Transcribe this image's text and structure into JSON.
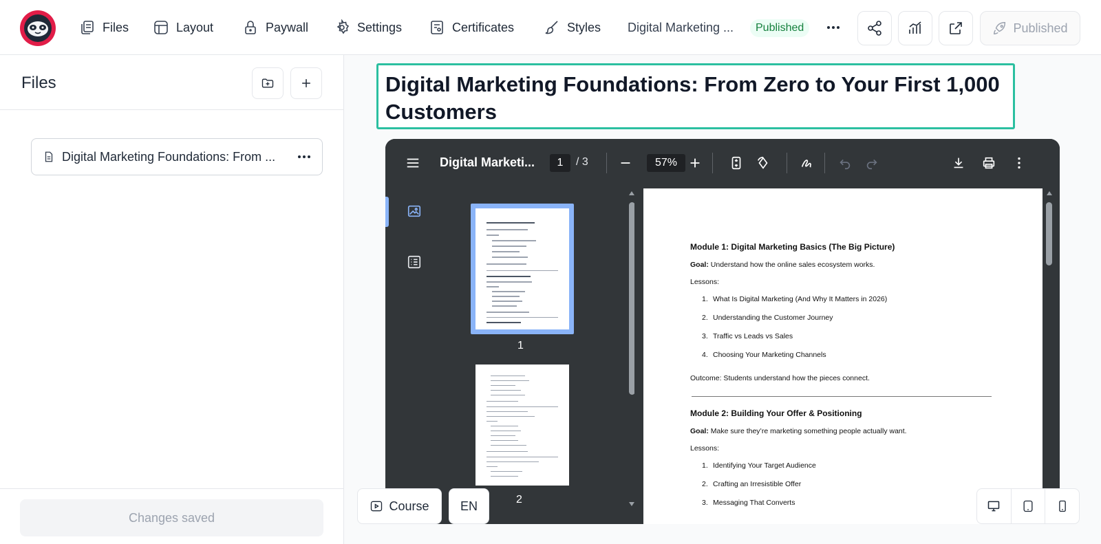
{
  "topbar": {
    "nav": [
      {
        "label": "Files",
        "icon": "files-icon"
      },
      {
        "label": "Layout",
        "icon": "layout-icon"
      },
      {
        "label": "Paywall",
        "icon": "lock-icon"
      },
      {
        "label": "Settings",
        "icon": "gear-icon"
      },
      {
        "label": "Certificates",
        "icon": "certificate-icon"
      },
      {
        "label": "Styles",
        "icon": "brush-icon"
      }
    ],
    "course_name": "Digital Marketing ...",
    "status_badge": "Published",
    "publish_button": "Published",
    "accent_color": "#2bbfa0"
  },
  "sidebar": {
    "title": "Files",
    "file_item": "Digital Marketing Foundations: From ...",
    "footer_status": "Changes saved"
  },
  "main": {
    "page_title": "Digital Marketing Foundations: From Zero to Your First 1,000 Customers",
    "viewer": {
      "doc_title": "Digital Marketi...",
      "current_page": "1",
      "total_pages": "/ 3",
      "zoom": "57%",
      "thumb_labels": [
        "1",
        "2"
      ],
      "content": {
        "module1_heading": "Module 1: Digital Marketing Basics (The Big Picture)",
        "module1_goal_label": "Goal:",
        "module1_goal": "Understand how the online sales ecosystem works.",
        "lessons_label": "Lessons:",
        "module1_lessons": [
          "What Is Digital Marketing (And Why It Matters in 2026)",
          "Understanding the Customer Journey",
          "Traffic vs Leads vs Sales",
          "Choosing Your Marketing Channels"
        ],
        "module1_outcome": "Outcome: Students understand how the pieces connect.",
        "module2_heading": "Module 2: Building Your Offer & Positioning",
        "module2_goal_label": "Goal:",
        "module2_goal": "Make sure they’re marketing something people actually want.",
        "module2_lessons": [
          "Identifying Your Target Audience",
          "Crafting an Irresistible Offer",
          "Messaging That Converts"
        ]
      }
    },
    "bottom": {
      "course_button": "Course",
      "language": "EN"
    }
  }
}
